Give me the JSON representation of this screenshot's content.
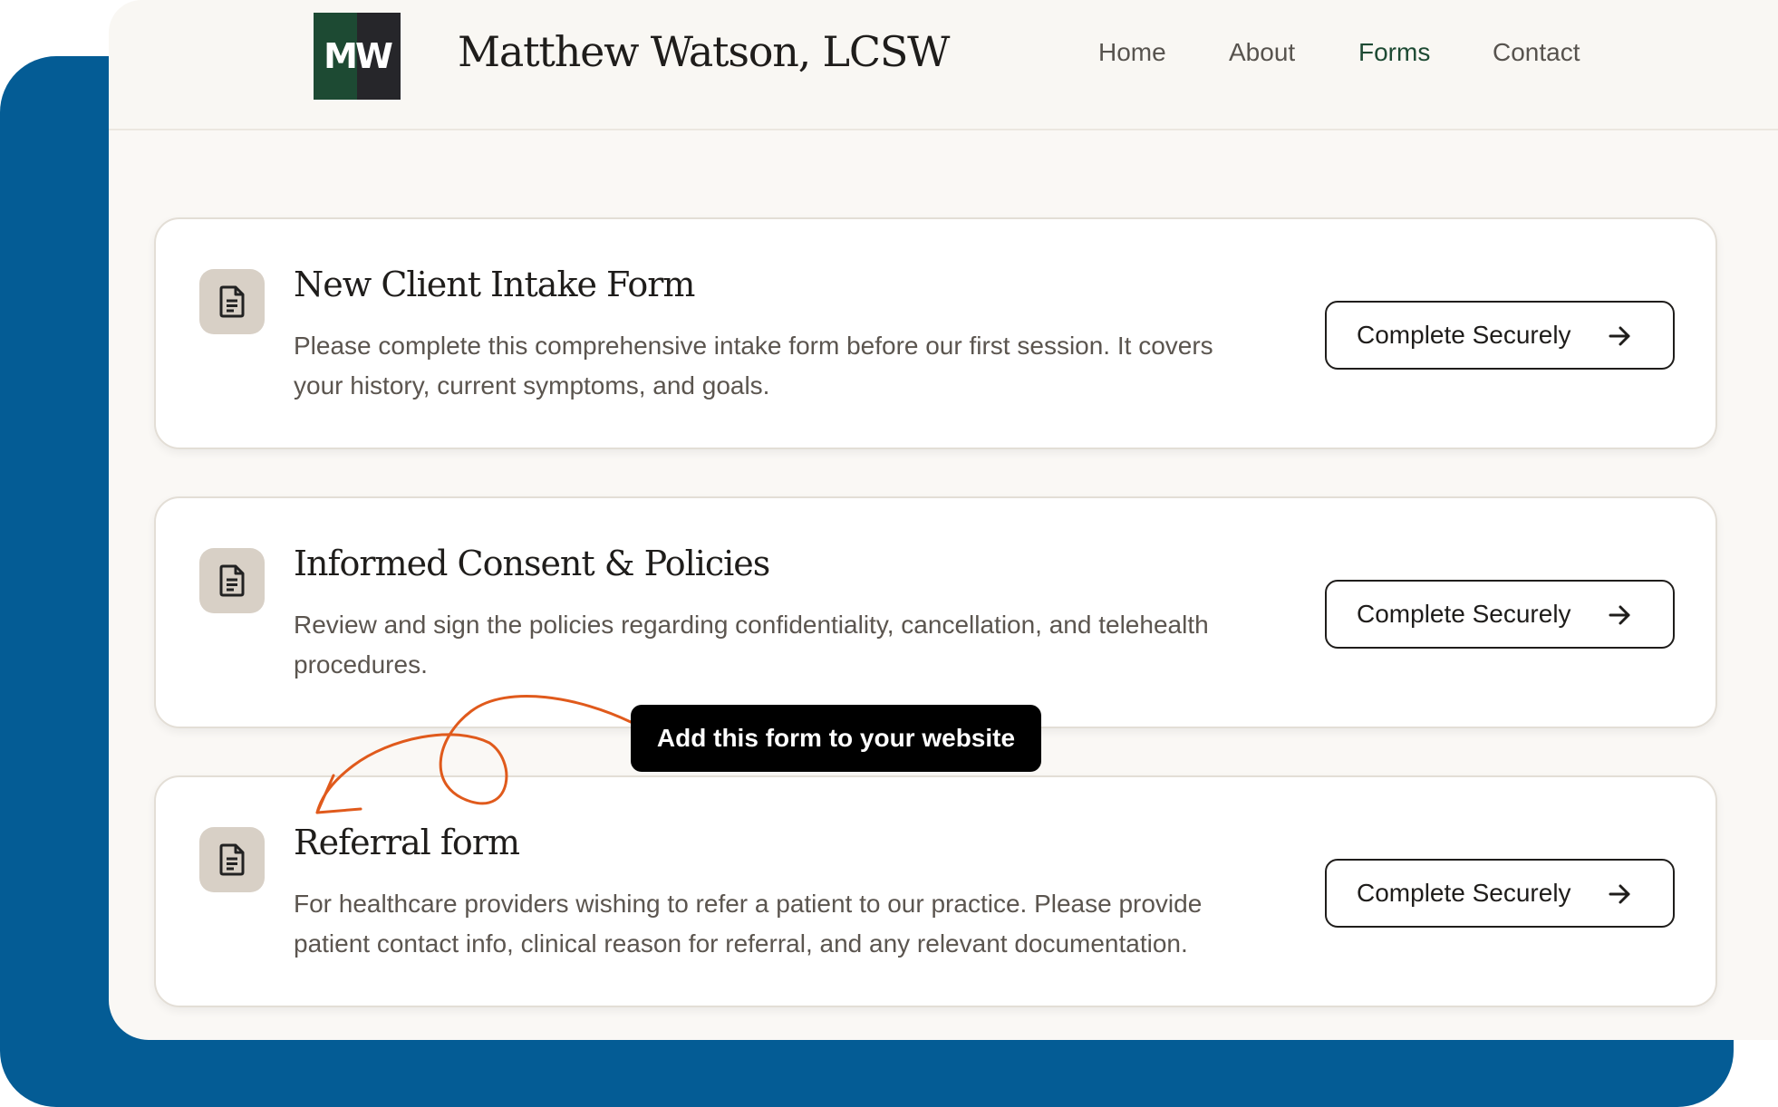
{
  "brand": {
    "logo_text": "MW",
    "site_title": "Matthew Watson, LCSW",
    "colors": {
      "green": "#1d4a33",
      "dark": "#26262a",
      "backdrop": "#045c95",
      "annotation": "#e05a1c"
    }
  },
  "nav": {
    "items": [
      {
        "label": "Home",
        "active": false
      },
      {
        "label": "About",
        "active": false
      },
      {
        "label": "Forms",
        "active": true
      },
      {
        "label": "Contact",
        "active": false
      }
    ]
  },
  "forms": [
    {
      "title": "New Client Intake Form",
      "description": "Please complete this comprehensive intake form before our first session. It covers your history, current symptoms, and goals.",
      "button_label": "Complete Securely",
      "icon": "document-icon"
    },
    {
      "title": "Informed Consent & Policies",
      "description": "Review and sign the policies regarding confidentiality, cancellation, and telehealth procedures.",
      "button_label": "Complete Securely",
      "icon": "document-icon"
    },
    {
      "title": "Referral form",
      "description": "For healthcare providers wishing to refer a patient to our practice. Please provide patient contact info, clinical reason for referral, and any relevant documentation.",
      "button_label": "Complete Securely",
      "icon": "document-icon"
    }
  ],
  "annotation": {
    "tooltip": "Add this form to your website"
  }
}
